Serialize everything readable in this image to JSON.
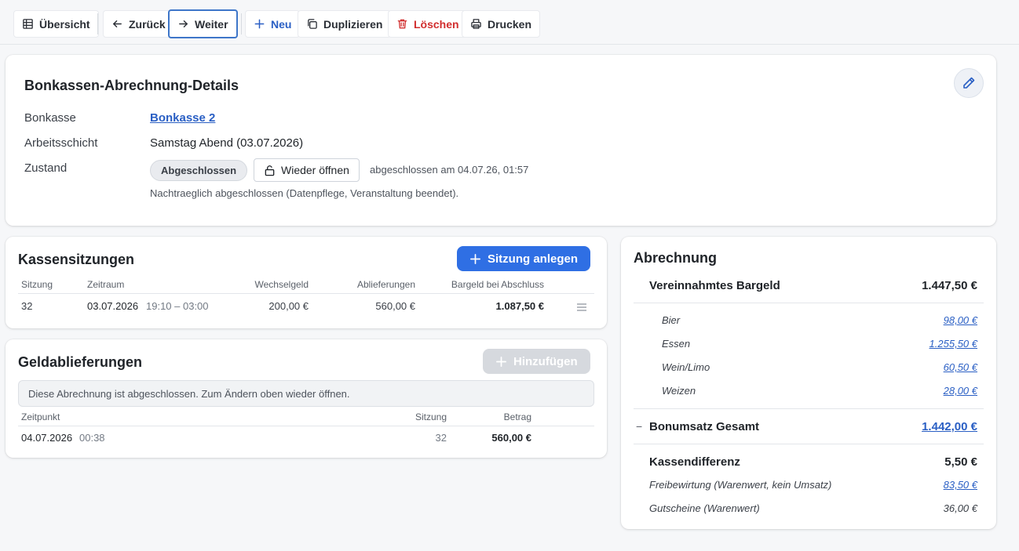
{
  "toolbar": {
    "overview": "Übersicht",
    "back": "Zurück",
    "next": "Weiter",
    "new": "Neu",
    "duplicate": "Duplizieren",
    "delete": "Löschen",
    "print": "Drucken"
  },
  "details": {
    "title": "Bonkassen-Abrechnung-Details",
    "register_label": "Bonkasse",
    "register_value": "Bonkasse 2",
    "shift_label": "Arbeitsschicht",
    "shift_value": "Samstag Abend (03.07.2026)",
    "state_label": "Zustand",
    "state_badge": "Abgeschlossen",
    "reopen_button": "Wieder öffnen",
    "closed_at": "abgeschlossen am 04.07.26, 01:57",
    "note": "Nachtraeglich abgeschlossen (Datenpflege, Veranstaltung beendet)."
  },
  "sessions": {
    "title": "Kassensitzungen",
    "create_button": "Sitzung anlegen",
    "columns": [
      "Sitzung",
      "Zeitraum",
      "Wechselgeld",
      "Ablieferungen",
      "Bargeld bei Abschluss"
    ],
    "rows": [
      {
        "session": "32",
        "date": "03.07.2026",
        "time": "19:10 – 03:00",
        "change": "200,00 €",
        "deliveries": "560,00 €",
        "cash": "1.087,50 €"
      }
    ]
  },
  "deliveries": {
    "title": "Geldablieferungen",
    "add_button": "Hinzufügen",
    "info": "Diese Abrechnung ist abgeschlossen. Zum Ändern oben wieder öffnen.",
    "columns": [
      "Zeitpunkt",
      "Sitzung",
      "Betrag"
    ],
    "rows": [
      {
        "date": "04.07.2026",
        "time": "00:38",
        "session": "32",
        "amount": "560,00 €"
      }
    ]
  },
  "billing": {
    "title": "Abrechnung",
    "cash_label": "Vereinnahmtes Bargeld",
    "cash_value": "1.447,50 €",
    "items": [
      {
        "label": "Bier",
        "value": "98,00 €"
      },
      {
        "label": "Essen",
        "value": "1.255,50 €"
      },
      {
        "label": "Wein/Limo",
        "value": "60,50 €"
      },
      {
        "label": "Weizen",
        "value": "28,00 €"
      }
    ],
    "bon_sign": "−",
    "bon_label": "Bonumsatz Gesamt",
    "bon_value": "1.442,00 €",
    "diff_label": "Kassendifferenz",
    "diff_value": "5,50 €",
    "free_label": "Freibewirtung (Warenwert, kein Umsatz)",
    "free_value": "83,50 €",
    "voucher_label": "Gutscheine (Warenwert)",
    "voucher_value": "36,00 €"
  },
  "colors": {
    "accent": "#2f6fe4",
    "link": "#2a5fc4",
    "danger": "#d12e2e"
  }
}
